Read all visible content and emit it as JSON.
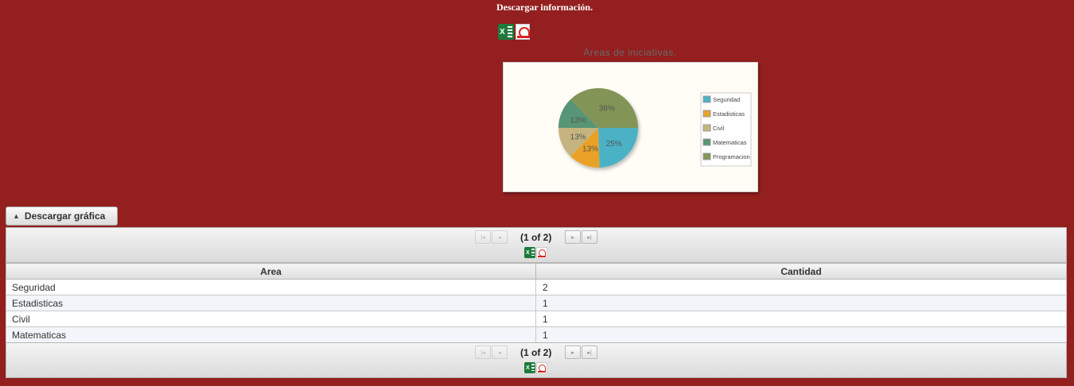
{
  "download_info": {
    "title": "Descargar información."
  },
  "top_icons": [
    "excel-icon",
    "pdf-icon"
  ],
  "chart_title": "Áreas de iniciativas.",
  "chart_data": {
    "type": "pie",
    "title": "Áreas de iniciativas.",
    "slices": [
      {
        "label": "Seguridad",
        "percent": 25,
        "color": "#4bb2c5"
      },
      {
        "label": "Estadisticas",
        "percent": 13,
        "color": "#eaa228"
      },
      {
        "label": "Civil",
        "percent": 13,
        "color": "#c5b47f"
      },
      {
        "label": "Matematicas",
        "percent": 13,
        "color": "#579575"
      },
      {
        "label": "Programacion",
        "percent": 38,
        "color": "#839557"
      }
    ],
    "data_labels": [
      "25%",
      "13%",
      "13%",
      "13%",
      "38%"
    ],
    "legend": {
      "position": "right"
    }
  },
  "download_chart_button": {
    "label": "Descargar gráfica",
    "icon": "chevron-up-icon"
  },
  "paginator": {
    "top_text": "(1 of 2)",
    "bottom_text": "(1 of 2)",
    "buttons": {
      "first": "first-page",
      "prev": "previous-page",
      "next": "next-page",
      "last": "last-page"
    }
  },
  "table": {
    "columns": [
      "Area",
      "Cantidad"
    ],
    "rows": [
      [
        "Seguridad",
        "2"
      ],
      [
        "Estadisticas",
        "1"
      ],
      [
        "Civil",
        "1"
      ],
      [
        "Matematicas",
        "1"
      ]
    ]
  }
}
